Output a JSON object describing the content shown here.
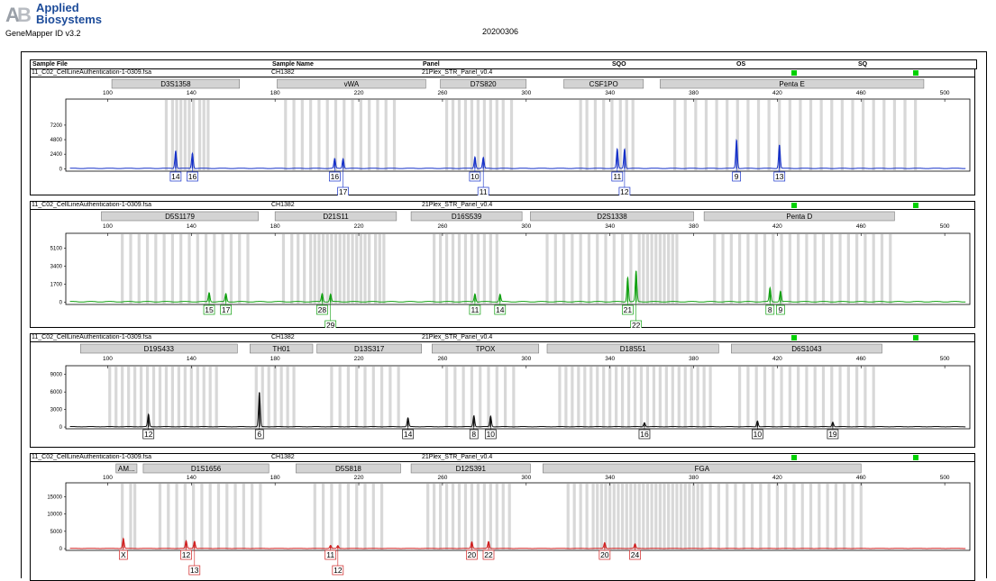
{
  "app": {
    "brand_line1": "Applied",
    "brand_line2": "Biosystems",
    "software": "GeneMapper ID v3.2",
    "run_label": "20200306"
  },
  "header": {
    "sample_file": "Sample File",
    "sample_name": "Sample Name",
    "panel": "Panel",
    "sqo": "SQO",
    "os": "OS",
    "sq": "SQ"
  },
  "colors": {
    "status_ok": "#00d000",
    "bin": "#d8d8d8",
    "locus_box": "#d3d3d3"
  },
  "chart_data": [
    {
      "type": "line",
      "sample_file": "11_C02_CellLineAuthentication-1-0309.fsa",
      "sample_name": "CH1382",
      "panel": "21Plex_STR_Panel_v0.4",
      "color": "#1530c8",
      "xlim": [
        80,
        512
      ],
      "x_ticks": [
        100,
        140,
        180,
        220,
        260,
        300,
        340,
        380,
        420,
        460,
        500
      ],
      "ylim": [
        -400,
        11500
      ],
      "y_ticks": [
        0,
        2400,
        4800,
        7200
      ],
      "loci": [
        {
          "name": "D3S1358",
          "start": 102,
          "end": 163
        },
        {
          "name": "vWA",
          "start": 181,
          "end": 252
        },
        {
          "name": "D7S820",
          "start": 259,
          "end": 300
        },
        {
          "name": "CSF1PO",
          "start": 318,
          "end": 356
        },
        {
          "name": "Penta E",
          "start": 364,
          "end": 490
        }
      ],
      "bins": [
        128,
        131,
        133,
        135,
        137,
        139,
        141,
        144,
        146,
        148,
        185,
        189,
        193,
        197,
        201,
        205,
        209,
        213,
        217,
        221,
        225,
        229,
        233,
        237,
        262,
        265,
        268,
        271,
        274,
        277,
        280,
        283,
        286,
        289,
        293,
        326,
        329,
        333,
        337,
        341,
        345,
        348,
        351,
        371,
        376,
        381,
        386,
        391,
        396,
        401,
        406,
        411,
        416,
        421,
        426,
        431,
        436,
        441,
        446,
        451,
        456,
        461,
        466,
        471,
        476,
        481,
        486
      ],
      "peaks": [
        {
          "x": 132.5,
          "h": 2900,
          "allele": "14",
          "row": 1
        },
        {
          "x": 140.5,
          "h": 2500,
          "allele": "16",
          "row": 1
        },
        {
          "x": 208.5,
          "h": 1600,
          "allele": "16",
          "row": 1
        },
        {
          "x": 212.5,
          "h": 1600,
          "allele": "17",
          "row": 2
        },
        {
          "x": 275.5,
          "h": 1900,
          "allele": "10",
          "row": 1
        },
        {
          "x": 279.5,
          "h": 1800,
          "allele": "11",
          "row": 2
        },
        {
          "x": 343.5,
          "h": 3200,
          "allele": "11",
          "row": 1
        },
        {
          "x": 347,
          "h": 3200,
          "allele": "12",
          "row": 2
        },
        {
          "x": 400.5,
          "h": 4700,
          "allele": "9",
          "row": 1
        },
        {
          "x": 421,
          "h": 3900,
          "allele": "13",
          "row": 1
        }
      ]
    },
    {
      "type": "line",
      "sample_file": "11_C02_CellLineAuthentication-1-0309.fsa",
      "sample_name": "CH1382",
      "panel": "21Plex_STR_Panel_v0.4",
      "color": "#10a010",
      "xlim": [
        80,
        512
      ],
      "x_ticks": [
        100,
        140,
        180,
        220,
        260,
        300,
        340,
        380,
        420,
        460,
        500
      ],
      "ylim": [
        -200,
        6500
      ],
      "y_ticks": [
        0,
        1700,
        3400,
        5100
      ],
      "loci": [
        {
          "name": "D5S1179",
          "start": 97,
          "end": 172
        },
        {
          "name": "D21S11",
          "start": 180,
          "end": 238
        },
        {
          "name": "D16S539",
          "start": 245,
          "end": 298
        },
        {
          "name": "D2S1338",
          "start": 302,
          "end": 380
        },
        {
          "name": "Penta D",
          "start": 385,
          "end": 476
        }
      ],
      "bins": [
        107,
        111,
        115,
        119,
        123,
        127,
        131,
        135,
        139,
        143,
        147,
        151,
        155,
        159,
        163,
        167,
        184,
        188,
        191,
        194,
        197,
        199,
        201,
        203,
        205,
        207,
        209,
        211,
        213,
        215,
        217,
        219,
        221,
        223,
        225,
        228,
        230,
        232,
        256,
        259,
        262,
        265,
        268,
        271,
        274,
        277,
        280,
        283,
        286,
        310,
        314,
        318,
        322,
        326,
        330,
        334,
        338,
        342,
        346,
        350,
        354,
        356,
        358,
        360,
        362,
        364,
        366,
        368,
        370,
        372,
        390,
        394,
        398,
        402,
        406,
        410,
        414,
        418,
        422,
        426,
        430,
        434,
        438,
        442,
        446,
        450,
        454,
        458,
        462,
        466,
        470,
        474
      ],
      "peaks": [
        {
          "x": 148.5,
          "h": 860,
          "allele": "15",
          "row": 1
        },
        {
          "x": 156.5,
          "h": 760,
          "allele": "17",
          "row": 1
        },
        {
          "x": 202.5,
          "h": 780,
          "allele": "28",
          "row": 1
        },
        {
          "x": 206.5,
          "h": 720,
          "allele": "29",
          "row": 2
        },
        {
          "x": 275.5,
          "h": 760,
          "allele": "11",
          "row": 1
        },
        {
          "x": 287.5,
          "h": 700,
          "allele": "14",
          "row": 1
        },
        {
          "x": 348.5,
          "h": 2300,
          "allele": "21",
          "row": 1
        },
        {
          "x": 352.5,
          "h": 2900,
          "allele": "22",
          "row": 2
        },
        {
          "x": 416.5,
          "h": 1300,
          "allele": "8",
          "row": 1
        },
        {
          "x": 421.5,
          "h": 1000,
          "allele": "9",
          "row": 1
        }
      ]
    },
    {
      "type": "line",
      "sample_file": "11_C02_CellLineAuthentication-1-0309.fsa",
      "sample_name": "CH1382",
      "panel": "21Plex_STR_Panel_v0.4",
      "color": "#101010",
      "xlim": [
        80,
        512
      ],
      "x_ticks": [
        100,
        140,
        180,
        220,
        260,
        300,
        340,
        380,
        420,
        460,
        500
      ],
      "ylim": [
        -300,
        10500
      ],
      "y_ticks": [
        0,
        3000,
        6000,
        9000
      ],
      "loci": [
        {
          "name": "D19S433",
          "start": 87,
          "end": 162
        },
        {
          "name": "TH01",
          "start": 168,
          "end": 198
        },
        {
          "name": "D13S317",
          "start": 200,
          "end": 250
        },
        {
          "name": "TPOX",
          "start": 255,
          "end": 306
        },
        {
          "name": "D18S51",
          "start": 310,
          "end": 392
        },
        {
          "name": "D6S1043",
          "start": 398,
          "end": 470
        }
      ],
      "bins": [
        101,
        104,
        107,
        110,
        113,
        116,
        119,
        122,
        125,
        128,
        131,
        134,
        137,
        140,
        143,
        146,
        149,
        152,
        171,
        174,
        177,
        180,
        183,
        186,
        189,
        207,
        211,
        215,
        219,
        223,
        227,
        231,
        235,
        239,
        262,
        266,
        270,
        274,
        278,
        282,
        286,
        290,
        294,
        316,
        319,
        322,
        325,
        328,
        331,
        334,
        337,
        340,
        343,
        346,
        349,
        352,
        355,
        358,
        361,
        364,
        367,
        370,
        373,
        376,
        379,
        382,
        385,
        388,
        402,
        406,
        410,
        414,
        418,
        422,
        426,
        430,
        434,
        438,
        442,
        446,
        450,
        454,
        458,
        462,
        466
      ],
      "peaks": [
        {
          "x": 119.5,
          "h": 2100,
          "allele": "12",
          "row": 1
        },
        {
          "x": 172.5,
          "h": 5900,
          "allele": "6",
          "row": 1
        },
        {
          "x": 243.5,
          "h": 1500,
          "allele": "14",
          "row": 1
        },
        {
          "x": 275,
          "h": 1900,
          "allele": "8",
          "row": 1
        },
        {
          "x": 283,
          "h": 1800,
          "allele": "10",
          "row": 1
        },
        {
          "x": 356.5,
          "h": 700,
          "allele": "16",
          "row": 1
        },
        {
          "x": 410.5,
          "h": 1000,
          "allele": "10",
          "row": 1
        },
        {
          "x": 446.5,
          "h": 800,
          "allele": "19",
          "row": 1
        }
      ]
    },
    {
      "type": "line",
      "sample_file": "11_C02_CellLineAuthentication-1-0309.fsa",
      "sample_name": "CH1382",
      "panel": "21Plex_STR_Panel_v0.4",
      "color": "#d02020",
      "xlim": [
        80,
        512
      ],
      "x_ticks": [
        100,
        140,
        180,
        220,
        260,
        300,
        340,
        380,
        420,
        460,
        500
      ],
      "ylim": [
        -500,
        19000
      ],
      "y_ticks": [
        0,
        5000,
        10000,
        15000
      ],
      "loci": [
        {
          "name": "AM...",
          "start": 104,
          "end": 114
        },
        {
          "name": "D1S1656",
          "start": 117,
          "end": 177
        },
        {
          "name": "D5S818",
          "start": 190,
          "end": 240
        },
        {
          "name": "D12S391",
          "start": 245,
          "end": 302
        },
        {
          "name": "FGA",
          "start": 308,
          "end": 460
        }
      ],
      "bins": [
        107,
        111,
        113,
        125,
        129,
        133,
        137,
        141,
        145,
        149,
        153,
        157,
        161,
        165,
        169,
        173,
        199,
        203,
        207,
        211,
        215,
        219,
        223,
        227,
        231,
        253,
        256,
        259,
        262,
        265,
        268,
        271,
        274,
        277,
        280,
        283,
        286,
        289,
        292,
        320,
        323,
        326,
        329,
        332,
        334,
        336,
        338,
        340,
        342,
        344,
        346,
        348,
        350,
        352,
        354,
        356,
        358,
        360,
        362,
        364,
        366,
        368,
        370,
        372,
        374,
        376,
        378,
        380,
        382,
        384,
        388,
        392,
        396,
        400,
        404,
        408,
        412,
        416,
        420,
        424,
        428,
        432,
        436,
        440,
        444,
        448,
        452,
        456,
        460
      ],
      "peaks": [
        {
          "x": 107.5,
          "h": 2900,
          "allele": "X",
          "row": 1
        },
        {
          "x": 137.5,
          "h": 2200,
          "allele": "12",
          "row": 1
        },
        {
          "x": 141.5,
          "h": 2100,
          "allele": "13",
          "row": 2
        },
        {
          "x": 206.5,
          "h": 900,
          "allele": "11",
          "row": 1
        },
        {
          "x": 210,
          "h": 800,
          "allele": "12",
          "row": 2
        },
        {
          "x": 274,
          "h": 1900,
          "allele": "20",
          "row": 1
        },
        {
          "x": 282,
          "h": 2000,
          "allele": "22",
          "row": 1
        },
        {
          "x": 337.5,
          "h": 1700,
          "allele": "20",
          "row": 1
        },
        {
          "x": 352,
          "h": 1300,
          "allele": "24",
          "row": 1
        }
      ]
    }
  ]
}
